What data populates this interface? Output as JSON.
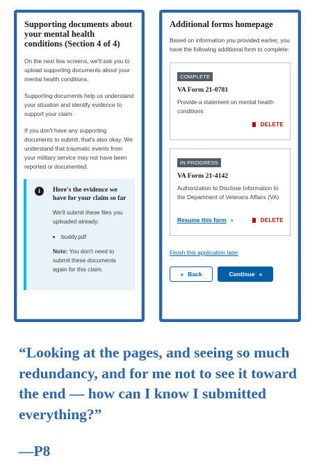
{
  "left_screen": {
    "title": "Supporting documents about your mental health conditions (Section 4 of 4)",
    "paragraphs": [
      "On the next few screens, we'll ask you to upload supporting documents about your mental health conditions.",
      "Supporting documents help us understand your situation and identify evidence to support your claim.",
      "If you don't have any supporting documents to submit, that's also okay. We understand that traumatic events from your military service may not have been reported or documented."
    ],
    "alert": {
      "icon": "info-icon",
      "title": "Here's the evidence we have for your claim so far",
      "text": "We'll submit these files you uploaded already:",
      "files": [
        "buddy.pdf"
      ],
      "note_label": "Note:",
      "note_text": " You don't need to submit these documents again for this claim."
    }
  },
  "right_screen": {
    "title": "Additional forms homepage",
    "intro": "Based on information you provided earlier, you have the following additional form to complete:",
    "cards": [
      {
        "status": "COMPLETE",
        "form": "VA Form 21-0781",
        "description": "Provide a statement on mental health conditions",
        "delete_label": "DELETE"
      },
      {
        "status": "IN PROGRESS",
        "form": "VA Form 21-4142",
        "description": "Authorization to Disclose Information to the Department of Veterans Affairs (VA)",
        "resume_label": "Resume this form",
        "delete_label": "DELETE"
      }
    ],
    "finish_later": "Finish this application later",
    "back_label": "Back",
    "continue_label": "Continue"
  },
  "quote": {
    "text": "“Looking at the pages, and seeing so much redundancy, and for me not to see it toward the end — how can I know I submitted everything?”",
    "attribution": "—P8",
    "color": "#2c64a8"
  },
  "colors": {
    "frame": "#2c64a8",
    "link": "#005ea2",
    "delete": "#b50909",
    "alert_bg": "#e7f2f9",
    "alert_border": "#00bde3"
  }
}
